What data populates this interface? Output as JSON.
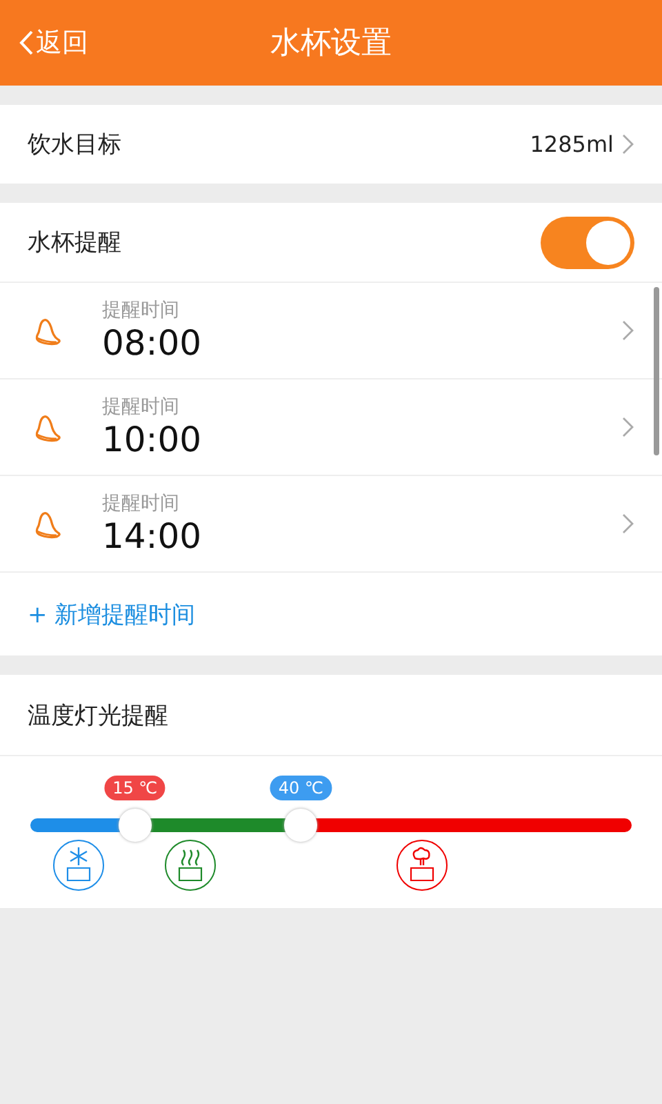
{
  "header": {
    "back": "返回",
    "title": "水杯设置"
  },
  "goal": {
    "label": "饮水目标",
    "value": "1285ml"
  },
  "reminder": {
    "label": "水杯提醒",
    "on": true,
    "times": [
      {
        "caption": "提醒时间",
        "time": "08:00"
      },
      {
        "caption": "提醒时间",
        "time": "10:00"
      },
      {
        "caption": "提醒时间",
        "time": "14:00"
      }
    ],
    "add": "+ 新增提醒时间"
  },
  "temperature": {
    "title": "温度灯光提醒",
    "zones": [
      {
        "kind": "cold",
        "color": "#1e8ee8"
      },
      {
        "kind": "warm",
        "color": "#1e8a2a"
      },
      {
        "kind": "hot",
        "color": "#f00000"
      }
    ],
    "thumbs": [
      {
        "label": "15 ℃",
        "level": 0.174,
        "color": "#f04646"
      },
      {
        "label": "40 ℃",
        "level": 0.45,
        "color": "#3d9cf0"
      }
    ]
  }
}
